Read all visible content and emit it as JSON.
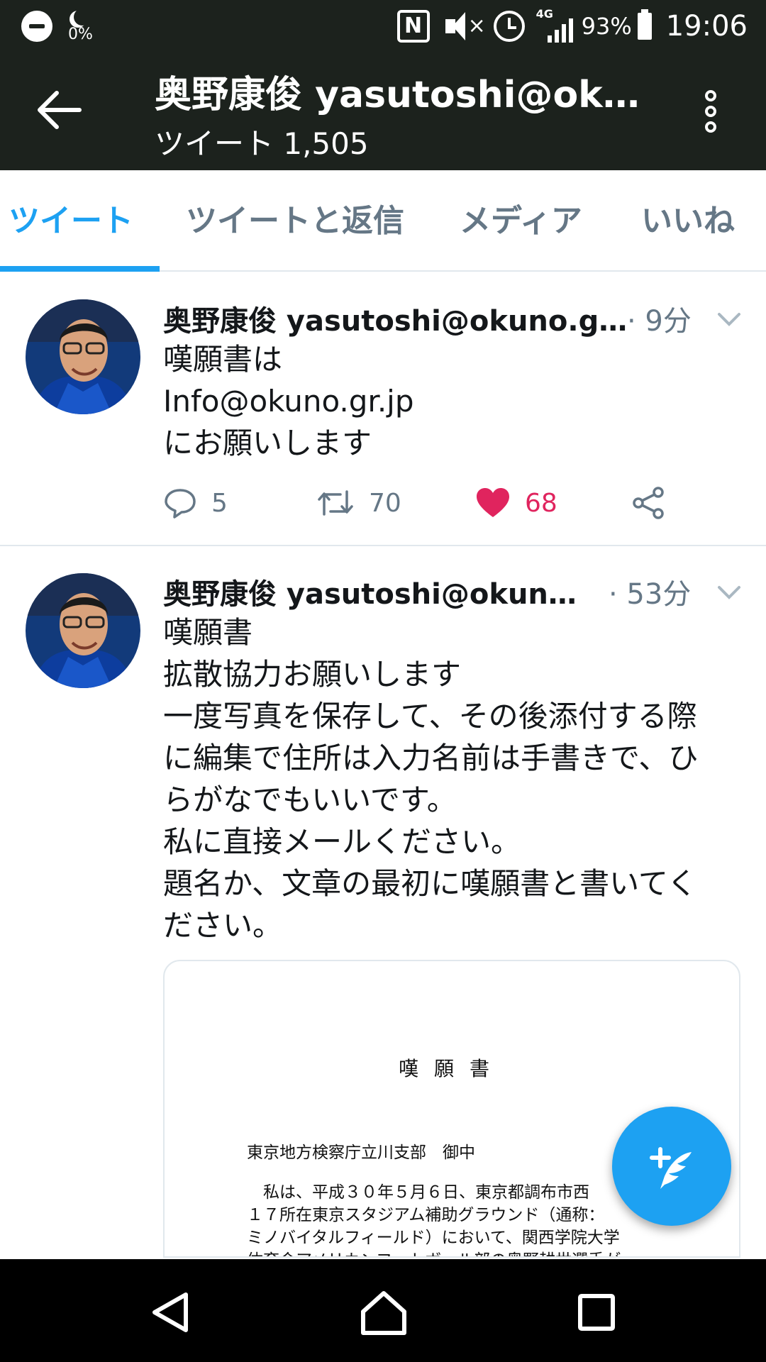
{
  "status_bar": {
    "data_saver_pct": "0%",
    "nfc_label": "N",
    "network": "4G",
    "battery": "93%",
    "time": "19:06"
  },
  "header": {
    "title": "奥野康俊 yasutoshi@okuno.gr.jp",
    "subtitle": "ツイート 1,505"
  },
  "tabs": [
    {
      "label": "ツイート",
      "active": true
    },
    {
      "label": "ツイートと返信",
      "active": false
    },
    {
      "label": "メディア",
      "active": false
    },
    {
      "label": "いいね",
      "active": false
    }
  ],
  "tweets": [
    {
      "name": "奥野康俊 yasutoshi@okuno.gr.jp",
      "time": "· 9分",
      "lines": [
        "嘆願書は",
        "Info@okuno.gr.jp",
        "にお願いします"
      ],
      "replies": "5",
      "retweets": "70",
      "likes": "68",
      "liked": true
    },
    {
      "name": "奥野康俊 yasutoshi@okuno.gr.jp",
      "time": "· 53分",
      "lines": [
        "嘆願書",
        "拡散協力お願いします",
        "一度写真を保存して、その後添付する際",
        "に編集で住所は入力名前は手書きで、ひ",
        "らがなでもいいです。",
        "私に直接メールください。",
        "題名か、文章の最初に嘆願書と書いてく",
        "ださい。"
      ],
      "media": {
        "doc_title": "嘆願書",
        "doc_addressee": "東京地方検察庁立川支部　御中",
        "doc_body": [
          "　私は、平成３０年５月６日、東京都調布市西",
          "１７所在東京スタジアム補助グラウンド（通称：",
          "ミノバイタルフィールド）において、関西学院大学",
          "体育会アメリカンフットボール部の奥野耕世選手が"
        ]
      }
    }
  ],
  "colors": {
    "header_bg": "#1c221d",
    "accent": "#1da1f2",
    "like": "#e0245e",
    "muted": "#657786"
  },
  "icons": {
    "back": "arrow-left-icon",
    "more": "more-vertical-icon",
    "reply": "speech-bubble-icon",
    "retweet": "retweet-icon",
    "like": "heart-icon",
    "share": "share-icon",
    "compose": "compose-feather-icon"
  }
}
